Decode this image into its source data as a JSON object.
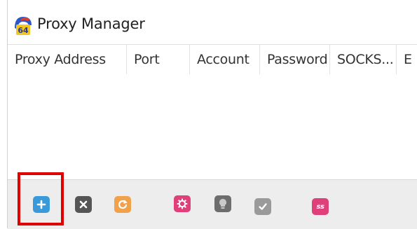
{
  "window": {
    "title": "Proxy Manager",
    "app_icon_badge": "64"
  },
  "table": {
    "columns": [
      "Proxy Address",
      "Port",
      "Account",
      "Password",
      "SOCKS...",
      "E"
    ],
    "rows": []
  },
  "toolbar": {
    "buttons": [
      {
        "name": "add",
        "icon": "plus-icon",
        "color": "#3a9ad9"
      },
      {
        "name": "delete",
        "icon": "close-icon",
        "color": "#555555"
      },
      {
        "name": "refresh",
        "icon": "refresh-icon",
        "color": "#f0a14a"
      },
      {
        "name": "settings",
        "icon": "gear-icon",
        "color": "#e0407a"
      },
      {
        "name": "test",
        "icon": "bulb-icon",
        "color": "#6d6d6d"
      },
      {
        "name": "confirm",
        "icon": "check-icon",
        "color": "#9a9a9a"
      },
      {
        "name": "ss",
        "icon": "ss-icon",
        "label": "ss",
        "color": "#e0407a"
      }
    ]
  },
  "highlight": {
    "target": "add",
    "color": "#e00000"
  }
}
